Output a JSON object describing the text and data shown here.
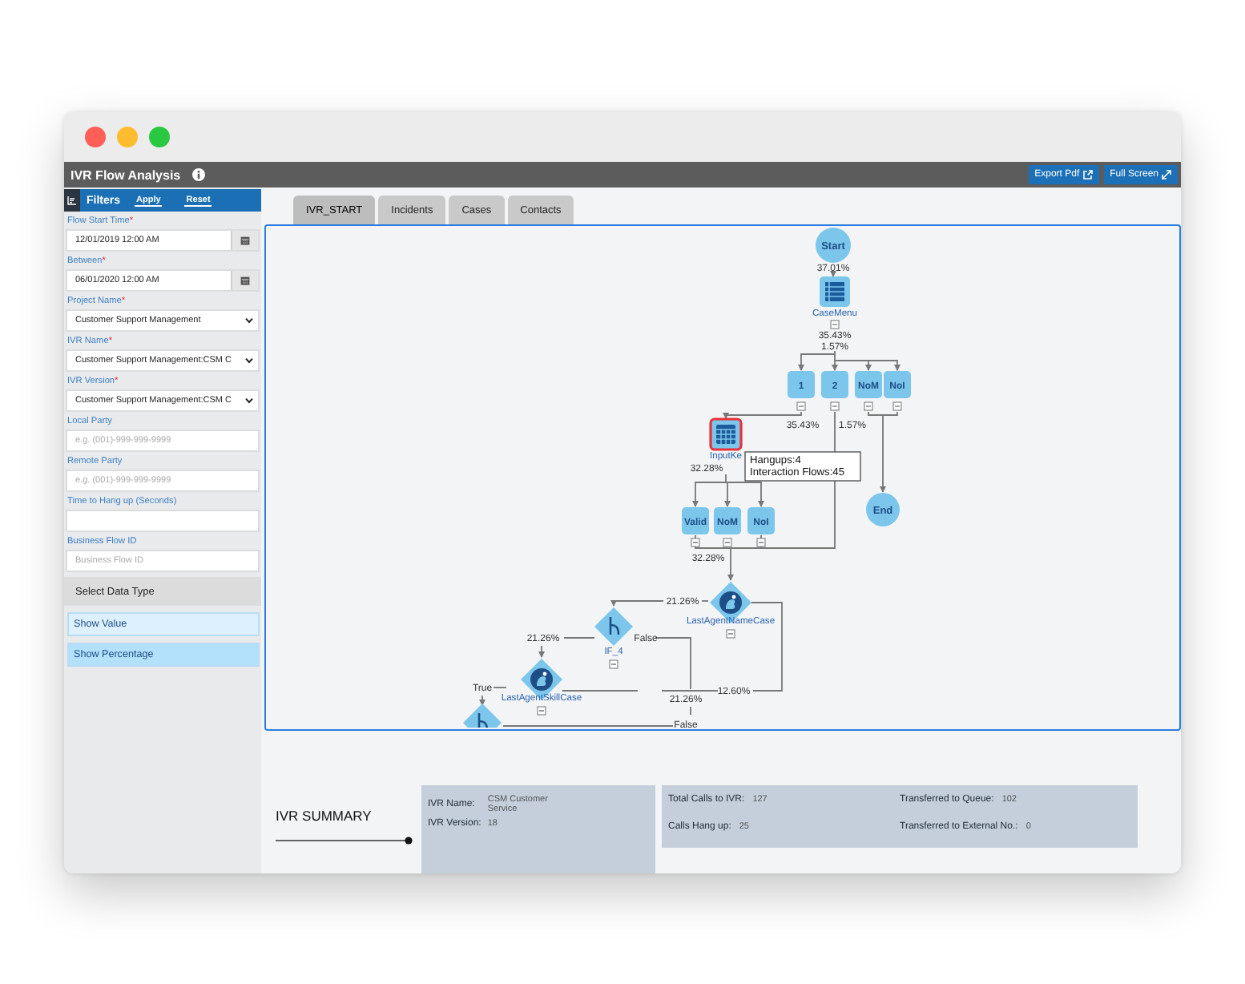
{
  "window": {
    "title": "IVR Flow Analysis"
  },
  "header_buttons": [
    {
      "label": "Export Pdf",
      "kind": "export"
    },
    {
      "label": "Full Screen",
      "kind": "fullscreen"
    }
  ],
  "filters": {
    "title": "Filters",
    "actions": [
      "Apply",
      "Reset"
    ],
    "fields": [
      {
        "kind": "date",
        "label": "Flow Start Time",
        "required_mark": "*",
        "value": "12/01/2019 12:00 AM"
      },
      {
        "kind": "date",
        "label": "Between",
        "required_mark": "*",
        "value": "06/01/2020 12:00 AM"
      },
      {
        "kind": "select",
        "label": "Project Name",
        "required_mark": "*",
        "value": "Customer Support Management"
      },
      {
        "kind": "select",
        "label": "IVR Name",
        "required_mark": "*",
        "value": "Customer Support Management:CSM C"
      },
      {
        "kind": "select",
        "label": "IVR Version",
        "required_mark": "*",
        "value": "Customer Support Management:CSM C"
      },
      {
        "kind": "text",
        "label": "Local Party",
        "placeholder": "e.g. (001)-999-999-9999"
      },
      {
        "kind": "text",
        "label": "Remote Party",
        "placeholder": "e.g. (001)-999-999-9999"
      },
      {
        "kind": "text",
        "label": "Time to Hang up (Seconds)"
      },
      {
        "kind": "text",
        "label": "Business Flow ID",
        "placeholder": "Business Flow ID"
      }
    ]
  },
  "data_type": {
    "title": "Select Data Type",
    "options": [
      {
        "label": "Show Value",
        "selected": false
      },
      {
        "label": "Show Percentage",
        "selected": true
      }
    ]
  },
  "tabs": [
    {
      "label": "IVR_START",
      "selected": true
    },
    {
      "label": "Incidents",
      "selected": false
    },
    {
      "label": "Cases",
      "selected": false
    },
    {
      "label": "Contacts",
      "selected": false
    }
  ],
  "flow": {
    "nodes": [
      {
        "kind": "circle",
        "label": "Start"
      },
      {
        "kind": "menu",
        "label": "CaseMenu"
      },
      {
        "kind": "box",
        "label": "1"
      },
      {
        "kind": "box",
        "label": "2"
      },
      {
        "kind": "box",
        "label": "NoM"
      },
      {
        "kind": "box",
        "label": "NoI"
      },
      {
        "kind": "keypad",
        "label": "InputKe",
        "highlighted": true
      },
      {
        "kind": "circle",
        "label": "End"
      },
      {
        "kind": "box",
        "label": "Valid"
      },
      {
        "kind": "box",
        "label": "NoM"
      },
      {
        "kind": "box",
        "label": "NoI"
      },
      {
        "kind": "agent",
        "label": "LastAgentNameCase"
      },
      {
        "kind": "branch",
        "label": "IF_4"
      },
      {
        "kind": "agent",
        "label": "LastAgentSkillCase"
      },
      {
        "kind": "branch"
      }
    ],
    "edge_labels": [
      "37.01%",
      "35.43%",
      "1.57%",
      "35.43%",
      "1.57%",
      "32.28%",
      "32.28%",
      "21.26%",
      "False",
      "21.26%",
      "True",
      "21.26%",
      "12.60%",
      "False"
    ],
    "tooltip": {
      "lines": [
        "Hangups:4",
        "Interaction Flows:45"
      ]
    }
  },
  "summary": {
    "title": "IVR SUMMARY",
    "details": [
      {
        "label": "IVR Name:",
        "value": "CSM Customer Service"
      },
      {
        "label": "IVR Version:",
        "value": "18"
      }
    ],
    "stats": [
      {
        "label": "Total Calls to IVR:",
        "value": "127"
      },
      {
        "label": "Transferred to Queue:",
        "value": "102"
      },
      {
        "label": "Calls Hang up:",
        "value": "25"
      },
      {
        "label": "Transferred to External No.:",
        "value": "0"
      }
    ]
  }
}
